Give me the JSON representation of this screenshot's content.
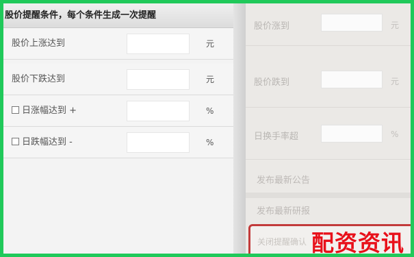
{
  "left_panel": {
    "header": "股价提醒条件，每个条件生成一次提醒",
    "rows": [
      {
        "label": "股价上涨达到",
        "value": "",
        "unit": "元",
        "has_checkbox": false
      },
      {
        "label": "股价下跌达到",
        "value": "",
        "unit": "元",
        "has_checkbox": false
      },
      {
        "label": "日涨幅达到 +",
        "value": "",
        "unit": "%",
        "has_checkbox": true
      },
      {
        "label": "日跌幅达到 -",
        "value": "",
        "unit": "%",
        "has_checkbox": true
      }
    ]
  },
  "right_panel": {
    "rows": [
      {
        "label": "股价涨到",
        "value": "",
        "unit": "元"
      },
      {
        "label": "股价跌到",
        "value": "",
        "unit": "元"
      },
      {
        "label": "日换手率超",
        "value": "",
        "unit": "%"
      }
    ],
    "links": [
      "发布最新公告",
      "发布最新研报"
    ],
    "highlight_text": "关闭提醒确认"
  },
  "watermark": "配资资讯",
  "colors": {
    "frame_border": "#20c95a",
    "highlight_border": "#c23a3a",
    "watermark": "#e8101a"
  }
}
